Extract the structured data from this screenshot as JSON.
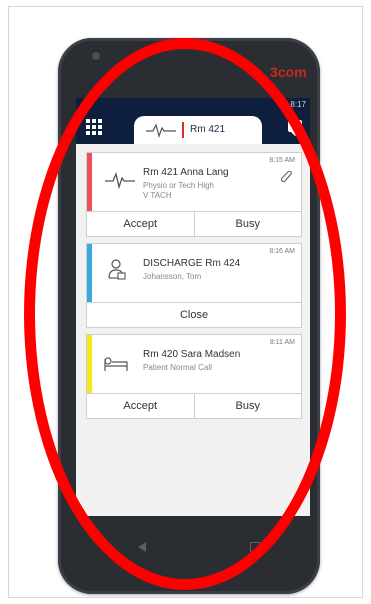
{
  "status_bar": {
    "time": "8:17"
  },
  "device": {
    "brand": "3com"
  },
  "header": {
    "room_tab": "Rm 421",
    "menu_icon": "grid-icon",
    "ecg_icon": "ecg-waveform-icon",
    "chat_icon": "chat-bubble-icon"
  },
  "alerts": [
    {
      "time": "8:15 AM",
      "title": "Rm 421  Anna Lang",
      "line1": "Physio or Tech High",
      "line2": "V TACH",
      "icon": "ecg-waveform-icon",
      "stripe_color": "#ef4f5a",
      "attachment_icon": "paperclip-icon",
      "actions": [
        "Accept",
        "Busy"
      ]
    },
    {
      "time": "8:16 AM",
      "title": "DISCHARGE  Rm 424",
      "line1": "Johansson, Tom",
      "icon": "patient-discharge-icon",
      "stripe_color": "#39a8e0",
      "actions": [
        "Close"
      ]
    },
    {
      "time": "8:11 AM",
      "title": "Rm 420  Sara Madsen",
      "line1": "Patient Normal Call",
      "icon": "patient-bed-icon",
      "stripe_color": "#f2e81d",
      "actions": [
        "Accept",
        "Busy"
      ]
    }
  ],
  "annotation": {
    "shape": "oval",
    "color": "#ff0000"
  }
}
